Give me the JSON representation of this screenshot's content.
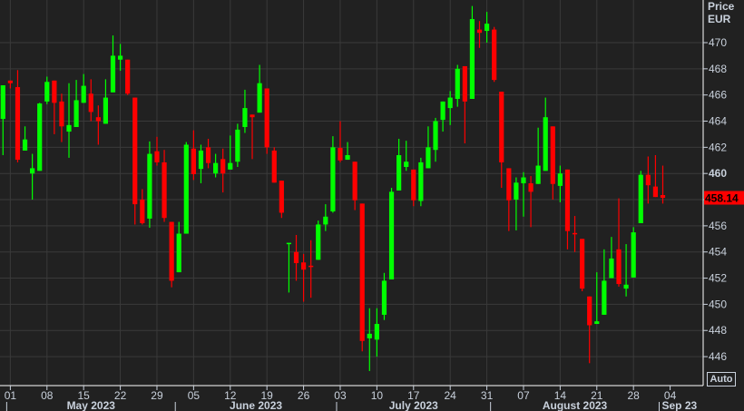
{
  "chart_data": {
    "type": "candlestick",
    "title": "",
    "currency_label": "Price",
    "currency_unit": "EUR",
    "last_price": "458.14",
    "ylim": [
      444.5,
      473.3
    ],
    "y_ticks": [
      446,
      448,
      450,
      452,
      454,
      456,
      458,
      460,
      462,
      464,
      466,
      468,
      470
    ],
    "y_tick_bold": 460,
    "grid": true,
    "colors": {
      "up": "#00ff00",
      "down": "#ff0000",
      "background": "#212121",
      "grid": "#3a3a3a",
      "last_price_bg": "#ff0000"
    },
    "x_ticks": [
      {
        "label": "01",
        "index": 1
      },
      {
        "label": "08",
        "index": 6
      },
      {
        "label": "15",
        "index": 11
      },
      {
        "label": "22",
        "index": 16
      },
      {
        "label": "29",
        "index": 21
      },
      {
        "label": "05",
        "index": 26
      },
      {
        "label": "12",
        "index": 31
      },
      {
        "label": "19",
        "index": 36
      },
      {
        "label": "26",
        "index": 41
      },
      {
        "label": "03",
        "index": 46
      },
      {
        "label": "10",
        "index": 51
      },
      {
        "label": "17",
        "index": 56
      },
      {
        "label": "24",
        "index": 61
      },
      {
        "label": "31",
        "index": 66
      },
      {
        "label": "07",
        "index": 71
      },
      {
        "label": "14",
        "index": 76
      },
      {
        "label": "21",
        "index": 81
      },
      {
        "label": "28",
        "index": 86
      },
      {
        "label": "04",
        "index": 91
      }
    ],
    "months": [
      {
        "label": "May 2023",
        "start": 1,
        "end": 23
      },
      {
        "label": "June 2023",
        "start": 24,
        "end": 45
      },
      {
        "label": "July 2023",
        "start": 46,
        "end": 66
      },
      {
        "label": "August 2023",
        "start": 67,
        "end": 89
      },
      {
        "label": "Sep 23",
        "start": 90,
        "end": 92
      }
    ],
    "ohlc_fields": [
      "open",
      "high",
      "low",
      "close"
    ],
    "candles": [
      [
        464.17,
        466.74,
        461.4,
        466.74
      ],
      [
        467.1,
        467.1,
        466.5,
        466.9
      ],
      [
        466.6,
        467.9,
        460.85,
        461.05
      ],
      [
        461.75,
        463.6,
        461.75,
        462.6
      ],
      [
        460.0,
        461.5,
        458.0,
        460.4
      ],
      [
        460.2,
        465.4,
        460.2,
        465.35
      ],
      [
        465.5,
        467.4,
        465.3,
        467.0
      ],
      [
        467.1,
        467.1,
        463.0,
        465.4
      ],
      [
        465.5,
        466.1,
        462.4,
        463.6
      ],
      [
        463.2,
        466.9,
        461.2,
        463.7
      ],
      [
        463.55,
        467.15,
        463.55,
        465.6
      ],
      [
        465.4,
        467.6,
        465.4,
        466.7
      ],
      [
        466.1,
        467.2,
        464.0,
        464.7
      ],
      [
        464.3,
        465.2,
        462.2,
        464.0
      ],
      [
        463.8,
        467.2,
        463.8,
        465.8
      ],
      [
        466.2,
        470.55,
        466.2,
        469.0
      ],
      [
        468.7,
        469.9,
        467.85,
        469.0
      ],
      [
        468.7,
        468.7,
        466.0,
        466.1
      ],
      [
        465.8,
        465.8,
        456.1,
        457.65
      ],
      [
        458.0,
        458.8,
        456.1,
        456.2
      ],
      [
        456.55,
        462.45,
        455.85,
        461.5
      ],
      [
        461.7,
        462.8,
        460.6,
        460.85
      ],
      [
        460.85,
        461.8,
        456.3,
        456.6
      ],
      [
        456.3,
        456.3,
        451.3,
        451.8
      ],
      [
        452.45,
        456.3,
        452.45,
        455.4
      ],
      [
        455.4,
        462.4,
        455.4,
        462.2
      ],
      [
        461.9,
        463.3,
        459.5,
        459.95
      ],
      [
        460.35,
        462.2,
        459.25,
        461.75
      ],
      [
        462.0,
        462.65,
        460.4,
        460.8
      ],
      [
        460.0,
        461.5,
        459.7,
        460.8
      ],
      [
        461.1,
        461.9,
        458.55,
        460.0
      ],
      [
        460.3,
        462.9,
        460.3,
        460.8
      ],
      [
        460.9,
        463.8,
        460.5,
        463.35
      ],
      [
        463.55,
        466.4,
        463.1,
        465.0
      ],
      [
        464.5,
        464.5,
        461.1,
        464.3
      ],
      [
        464.65,
        468.3,
        464.65,
        466.9
      ],
      [
        466.5,
        466.5,
        461.5,
        462.0
      ],
      [
        461.75,
        462.0,
        459.3,
        459.3
      ],
      [
        459.45,
        459.45,
        456.6,
        457.0
      ],
      [
        454.6,
        454.7,
        450.9,
        454.7
      ],
      [
        454.0,
        455.3,
        451.8,
        453.15
      ],
      [
        453.2,
        453.85,
        450.2,
        452.65
      ],
      [
        452.95,
        454.9,
        450.5,
        452.9
      ],
      [
        453.4,
        456.4,
        453.4,
        456.1
      ],
      [
        456.1,
        457.65,
        455.6,
        456.7
      ],
      [
        457.1,
        462.85,
        457.0,
        462.0
      ],
      [
        461.95,
        464.0,
        460.85,
        461.0
      ],
      [
        461.05,
        462.4,
        461.05,
        461.4
      ],
      [
        460.9,
        460.9,
        457.2,
        457.95
      ],
      [
        457.7,
        457.7,
        446.4,
        447.2
      ],
      [
        447.4,
        449.7,
        444.9,
        447.75
      ],
      [
        447.3,
        449.7,
        446.0,
        448.5
      ],
      [
        449.2,
        452.4,
        448.8,
        451.8
      ],
      [
        451.9,
        458.9,
        451.9,
        458.6
      ],
      [
        458.7,
        462.65,
        458.7,
        461.4
      ],
      [
        460.5,
        462.5,
        460.2,
        460.9
      ],
      [
        460.3,
        460.3,
        457.5,
        457.95
      ],
      [
        457.9,
        461.2,
        457.5,
        460.85
      ],
      [
        460.4,
        463.6,
        460.4,
        462.0
      ],
      [
        461.8,
        464.25,
        460.9,
        464.0
      ],
      [
        464.1,
        465.5,
        463.2,
        465.5
      ],
      [
        465.0,
        466.3,
        463.7,
        465.8
      ],
      [
        465.7,
        468.3,
        465.1,
        468.0
      ],
      [
        468.2,
        468.2,
        462.3,
        465.5
      ],
      [
        465.7,
        472.8,
        465.7,
        471.8
      ],
      [
        471.0,
        471.65,
        469.6,
        470.75
      ],
      [
        470.9,
        472.35,
        470.0,
        471.45
      ],
      [
        471.0,
        471.2,
        467.0,
        467.15
      ],
      [
        466.25,
        466.25,
        458.9,
        460.85
      ],
      [
        460.4,
        460.4,
        455.6,
        457.95
      ],
      [
        458.0,
        459.7,
        455.65,
        459.3
      ],
      [
        459.25,
        460.1,
        456.7,
        459.7
      ],
      [
        459.25,
        459.8,
        455.9,
        458.6
      ],
      [
        459.2,
        463.5,
        459.2,
        460.6
      ],
      [
        460.2,
        465.8,
        460.2,
        464.3
      ],
      [
        463.6,
        463.6,
        458.0,
        459.2
      ],
      [
        459.05,
        460.6,
        457.8,
        460.0
      ],
      [
        460.3,
        460.3,
        454.2,
        455.6
      ],
      [
        455.45,
        456.75,
        454.0,
        455.35
      ],
      [
        455.0,
        455.0,
        451.0,
        451.2
      ],
      [
        450.6,
        450.6,
        445.5,
        448.4
      ],
      [
        448.5,
        452.45,
        448.5,
        448.7
      ],
      [
        449.2,
        454.2,
        449.2,
        451.8
      ],
      [
        452.0,
        455.15,
        452.0,
        453.5
      ],
      [
        454.2,
        458.1,
        451.35,
        451.55
      ],
      [
        451.2,
        454.6,
        450.6,
        451.5
      ],
      [
        452.05,
        455.9,
        452.05,
        455.5
      ],
      [
        456.2,
        460.2,
        456.2,
        459.9
      ],
      [
        459.9,
        461.3,
        457.7,
        459.1
      ],
      [
        459.0,
        461.4,
        458.2,
        458.2
      ],
      [
        458.35,
        460.6,
        457.7,
        458.14
      ]
    ]
  },
  "controls": {
    "auto_label": "Auto"
  }
}
